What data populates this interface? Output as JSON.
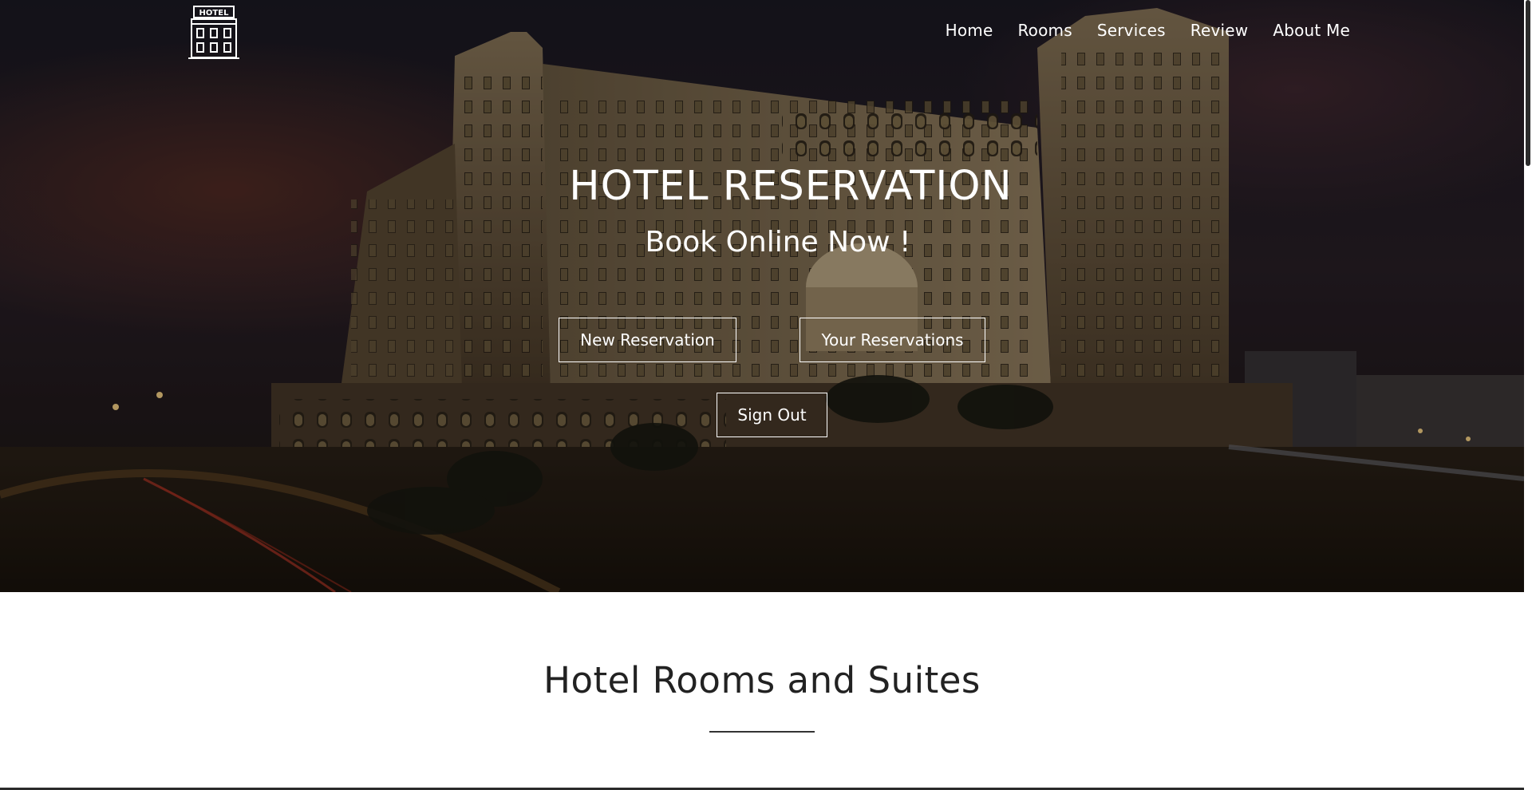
{
  "logo": {
    "text": "HOTEL",
    "icon": "hotel-building-icon"
  },
  "nav": {
    "items": [
      {
        "label": "Home"
      },
      {
        "label": "Rooms"
      },
      {
        "label": "Services"
      },
      {
        "label": "Review"
      },
      {
        "label": "About Me"
      }
    ]
  },
  "hero": {
    "title": "HOTEL RESERVATION",
    "subtitle": "Book Online Now !",
    "new_reservation_label": "New Reservation",
    "your_reservations_label": "Your Reservations",
    "sign_out_label": "Sign Out"
  },
  "section": {
    "title": "Hotel Rooms and Suites"
  },
  "colors": {
    "text_light": "#ffffff",
    "text_dark": "#222222",
    "hero_overlay": "#1d1820"
  }
}
